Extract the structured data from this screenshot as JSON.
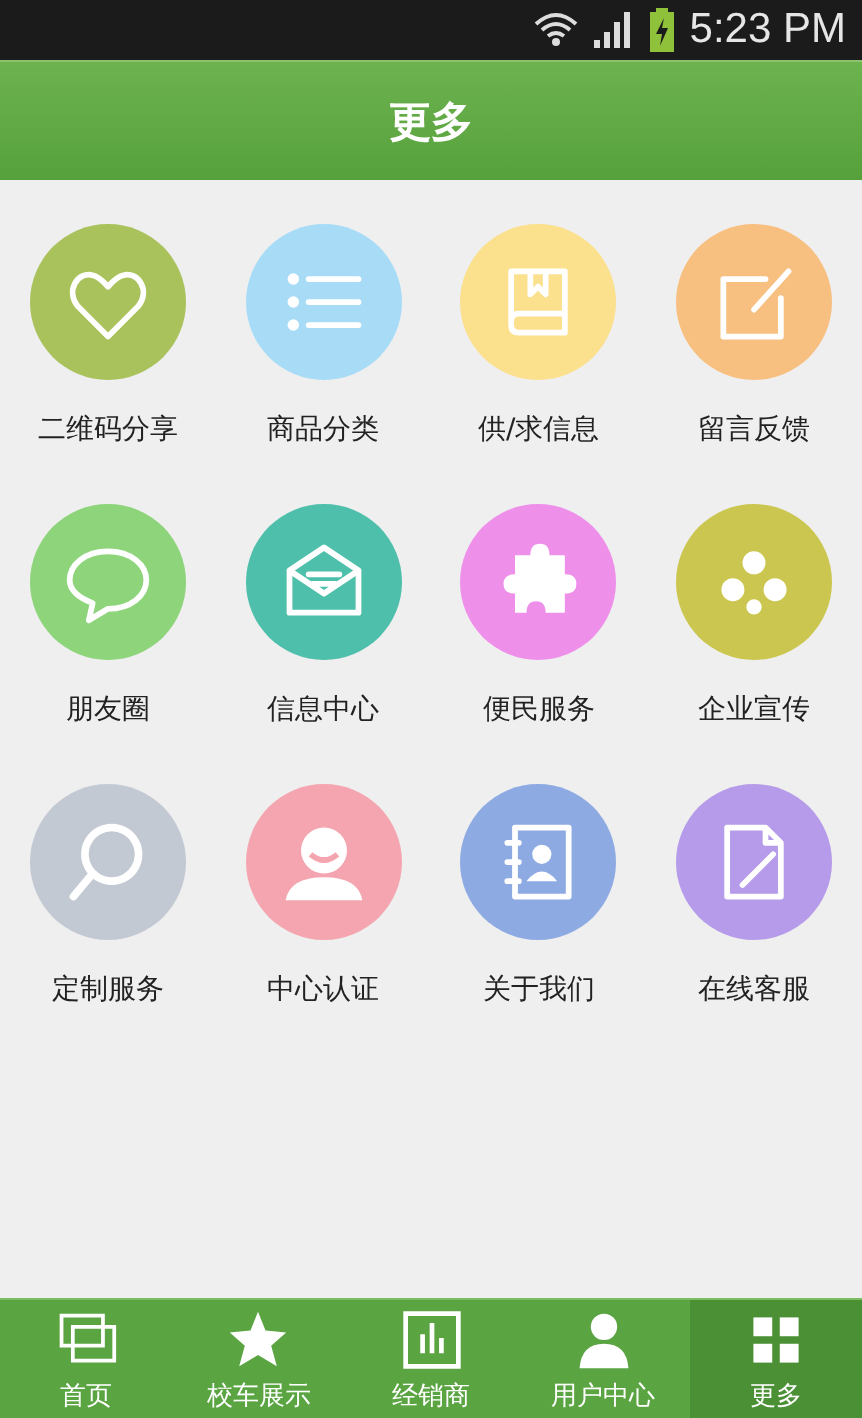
{
  "status_bar": {
    "time": "5:23 PM"
  },
  "header": {
    "title": "更多"
  },
  "grid": [
    {
      "label": "二维码分享",
      "color": "#a9c25b"
    },
    {
      "label": "商品分类",
      "color": "#a8dcf6"
    },
    {
      "label": "供/求信息",
      "color": "#fbe08e"
    },
    {
      "label": "留言反馈",
      "color": "#f8c080"
    },
    {
      "label": "朋友圈",
      "color": "#8dd47a"
    },
    {
      "label": "信息中心",
      "color": "#4dbfaa"
    },
    {
      "label": "便民服务",
      "color": "#ee90ea"
    },
    {
      "label": "企业宣传",
      "color": "#cbc64f"
    },
    {
      "label": "定制服务",
      "color": "#c3c9d3"
    },
    {
      "label": "中心认证",
      "color": "#f5a5b0"
    },
    {
      "label": "关于我们",
      "color": "#8eaae2"
    },
    {
      "label": "在线客服",
      "color": "#b59be9"
    }
  ],
  "tab_bar": [
    {
      "label": "首页",
      "selected": false
    },
    {
      "label": "校车展示",
      "selected": false
    },
    {
      "label": "经销商",
      "selected": false
    },
    {
      "label": "用户中心",
      "selected": false
    },
    {
      "label": "更多",
      "selected": true
    }
  ]
}
